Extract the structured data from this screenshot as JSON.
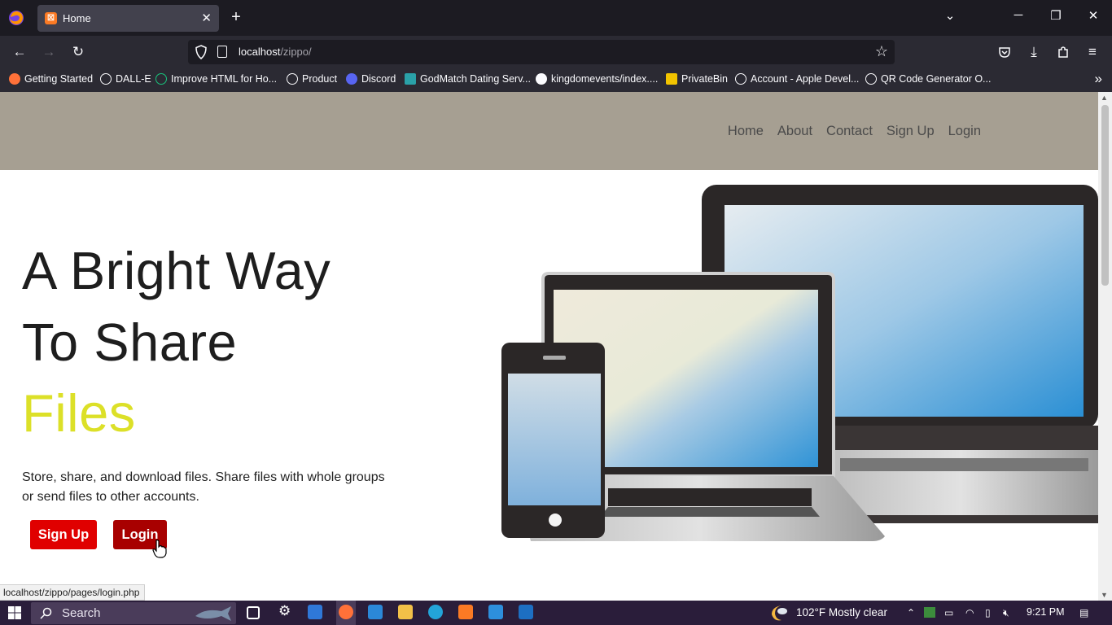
{
  "browser": {
    "tab": {
      "title": "Home",
      "favicon": "xampp-icon"
    },
    "url": {
      "host": "localhost",
      "path": "/zippo/"
    },
    "bookmarks": [
      {
        "label": "Getting Started",
        "icon": "firefox-icon"
      },
      {
        "label": "DALL-E",
        "icon": "globe-icon"
      },
      {
        "label": "Improve HTML for Ho...",
        "icon": "openai-icon"
      },
      {
        "label": "Product",
        "icon": "globe-icon"
      },
      {
        "label": "Discord",
        "icon": "discord-icon"
      },
      {
        "label": "GodMatch Dating Serv...",
        "icon": "godmatch-icon"
      },
      {
        "label": "kingdomevents/index....",
        "icon": "github-icon"
      },
      {
        "label": "PrivateBin",
        "icon": "privatebin-icon"
      },
      {
        "label": "Account - Apple Devel...",
        "icon": "globe-icon"
      },
      {
        "label": "QR Code Generator O...",
        "icon": "globe-icon"
      }
    ],
    "status_link": "localhost/zippo/pages/login.php"
  },
  "site": {
    "nav": [
      "Home",
      "About",
      "Contact",
      "Sign Up",
      "Login"
    ],
    "hero": {
      "line1": "A Bright Way",
      "line2": "To Share",
      "line3": "Files",
      "description": "Store, share, and download files. Share files with whole groups or send files to other accounts.",
      "signup_label": "Sign Up",
      "login_label": "Login"
    },
    "colors": {
      "header": "#a69f92",
      "accent": "#dce028",
      "signup": "#e00000",
      "login": "#a80000"
    }
  },
  "taskbar": {
    "search_placeholder": "Search",
    "weather": "102°F  Mostly clear",
    "time": "9:21 PM"
  }
}
